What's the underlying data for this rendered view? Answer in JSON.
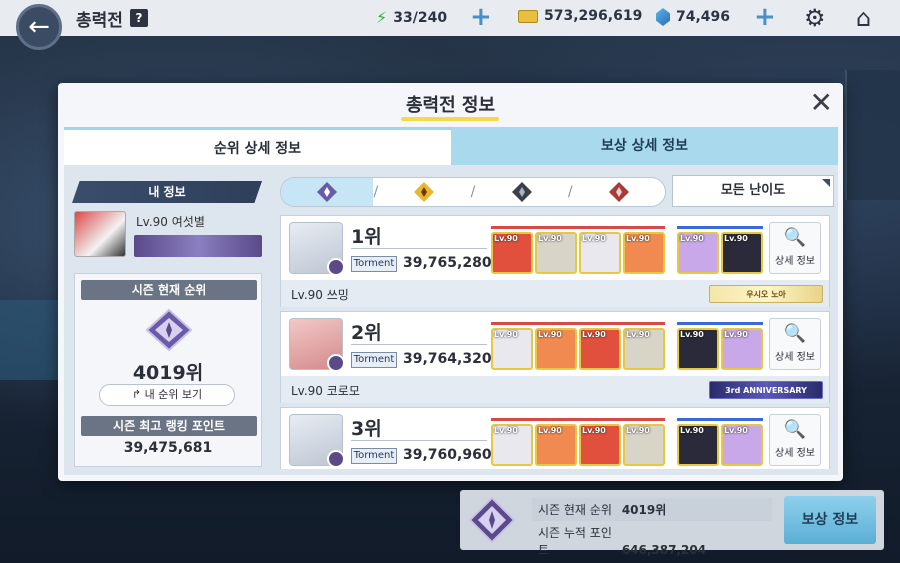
{
  "topbar": {
    "title": "총력전",
    "help": "?",
    "stamina": "33/240",
    "credits": "573,296,619",
    "gems": "74,496"
  },
  "dialog": {
    "title": "총력전 정보",
    "tabs": [
      "순위 상세 정보",
      "보상 상세 정보"
    ]
  },
  "my_info": {
    "header": "내 정보",
    "level_name": "Lv.90 여섯별",
    "season_rank_label": "시즌 현재 순위",
    "season_rank": "4019위",
    "my_rank_button": "내 순위 보기",
    "best_points_label": "시즌 최고 랭킹 포인트",
    "best_points": "39,475,681"
  },
  "difficulty": {
    "selected": "모든 난이도"
  },
  "rankings": [
    {
      "rank": "1위",
      "difficulty": "Torment",
      "points": "39,765,280",
      "name": "Lv.90 쓰밍",
      "title_badge": "우시오 노아",
      "detail_label": "상세 정보",
      "striker_colors": [
        "#e0503c",
        "#d8d4c8",
        "#e8e8ee",
        "#f08a50"
      ],
      "special_colors": [
        "#c8a8e8",
        "#2a2a3a"
      ]
    },
    {
      "rank": "2위",
      "difficulty": "Torment",
      "points": "39,764,320",
      "name": "Lv.90 코로모",
      "title_badge": "3rd ANNIVERSARY",
      "detail_label": "상세 정보",
      "striker_colors": [
        "#e8e8ee",
        "#f08a50",
        "#e0503c",
        "#d8d4c8"
      ],
      "special_colors": [
        "#2a2a3a",
        "#c8a8e8"
      ]
    },
    {
      "rank": "3위",
      "difficulty": "Torment",
      "points": "39,760,960",
      "name": "",
      "title_badge": "",
      "detail_label": "상세 정보",
      "striker_colors": [
        "#e8e8ee",
        "#f08a50",
        "#e0503c",
        "#d8d4c8"
      ],
      "special_colors": [
        "#2a2a3a",
        "#c8a8e8"
      ]
    }
  ],
  "bottom": {
    "rank_label": "시즌 현재 순위",
    "rank_value": "4019위",
    "points_label": "시즌 누적 포인트",
    "points_value": "646,387,204",
    "reward_button": "보상 정보"
  }
}
